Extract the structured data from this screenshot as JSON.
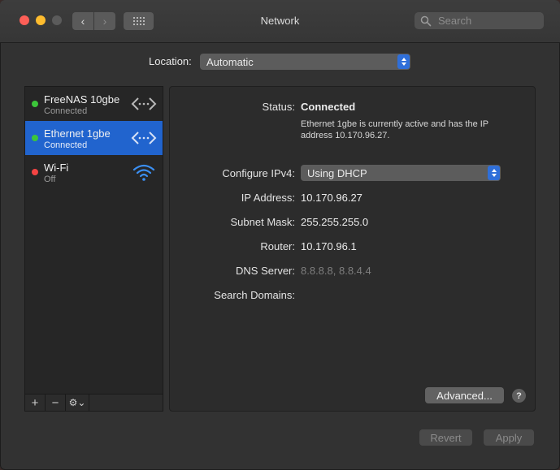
{
  "window": {
    "title": "Network"
  },
  "toolbar": {
    "back_glyph": "‹",
    "forward_glyph": "›",
    "search_placeholder": "Search"
  },
  "location": {
    "label": "Location:",
    "value": "Automatic"
  },
  "services": [
    {
      "name": "FreeNAS 10gbe",
      "state": "Connected",
      "status_color": "#3cc63a",
      "icon": "ethernet-arrows-icon",
      "selected": false
    },
    {
      "name": "Ethernet 1gbe",
      "state": "Connected",
      "status_color": "#3cc63a",
      "icon": "ethernet-arrows-icon",
      "selected": true
    },
    {
      "name": "Wi-Fi",
      "state": "Off",
      "status_color": "#f44443",
      "icon": "wifi-icon",
      "selected": false
    }
  ],
  "sidebar_buttons": {
    "add": "+",
    "remove": "−",
    "gear": "⚙︎⌄"
  },
  "detail": {
    "status_label": "Status:",
    "status_value": "Connected",
    "status_description": "Ethernet 1gbe is currently active and has the IP address 10.170.96.27.",
    "configure_label": "Configure IPv4:",
    "configure_value": "Using DHCP",
    "ip_label": "IP Address:",
    "ip_value": "10.170.96.27",
    "subnet_label": "Subnet Mask:",
    "subnet_value": "255.255.255.0",
    "router_label": "Router:",
    "router_value": "10.170.96.1",
    "dns_label": "DNS Server:",
    "dns_value": "8.8.8.8, 8.8.4.4",
    "search_domains_label": "Search Domains:",
    "advanced_label": "Advanced...",
    "help_label": "?"
  },
  "footer": {
    "revert_label": "Revert",
    "apply_label": "Apply"
  },
  "colors": {
    "accent": "#2164ce",
    "stepper": "#2f6fd9",
    "connected": "#3cc63a",
    "off": "#f44443"
  }
}
